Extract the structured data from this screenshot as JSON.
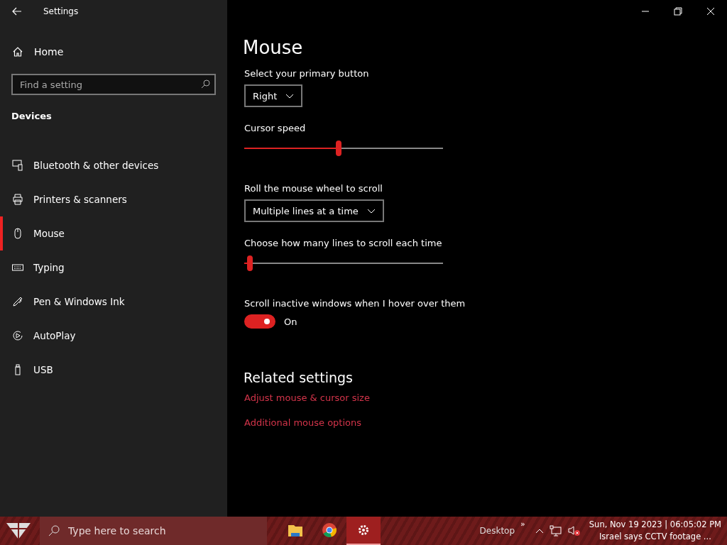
{
  "window": {
    "title": "Settings"
  },
  "sidebar": {
    "home": "Home",
    "search": {
      "placeholder": "Find a setting"
    },
    "section": "Devices",
    "items": [
      {
        "label": "Bluetooth & other devices",
        "selected": false
      },
      {
        "label": "Printers & scanners",
        "selected": false
      },
      {
        "label": "Mouse",
        "selected": true
      },
      {
        "label": "Typing",
        "selected": false
      },
      {
        "label": "Pen & Windows Ink",
        "selected": false
      },
      {
        "label": "AutoPlay",
        "selected": false
      },
      {
        "label": "USB",
        "selected": false
      }
    ]
  },
  "page": {
    "title": "Mouse",
    "settings": [
      {
        "kind": "dropdown",
        "label": "Select your primary button",
        "value": "Right"
      },
      {
        "kind": "slider",
        "label": "Cursor speed",
        "level": 0.475
      },
      {
        "kind": "dropdown",
        "label": "Roll the mouse wheel to scroll",
        "value": "Multiple lines at a time"
      },
      {
        "kind": "slider",
        "label": "Choose how many lines to scroll each time",
        "level": 0.03
      },
      {
        "kind": "toggle",
        "label": "Scroll inactive windows when I hover over them",
        "on": true,
        "state_text": "On"
      }
    ],
    "related": {
      "title": "Related settings",
      "links": [
        "Adjust mouse & cursor size",
        "Additional mouse options"
      ]
    }
  },
  "taskbar": {
    "search": {
      "placeholder": "Type here to search"
    },
    "apps": [
      {
        "selected": false
      },
      {
        "selected": false
      },
      {
        "selected": true
      }
    ],
    "desktop": "Desktop",
    "overflow": "»",
    "datetime": "Sun, Nov 19 2023 | 06:05:02 PM",
    "headline": "Israel says CCTV footage ..."
  }
}
